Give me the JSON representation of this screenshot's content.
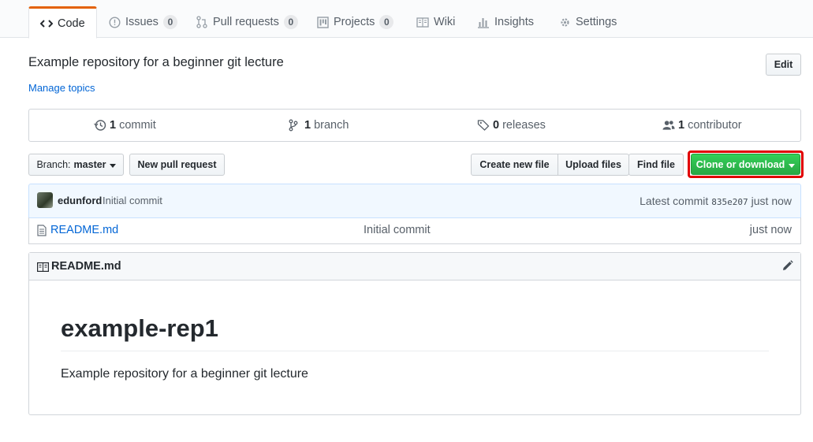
{
  "tabs": [
    {
      "label": "Code",
      "icon": "code-icon"
    },
    {
      "label": "Issues",
      "count": "0",
      "icon": "issue-icon"
    },
    {
      "label": "Pull requests",
      "count": "0",
      "icon": "pull-request-icon"
    },
    {
      "label": "Projects",
      "count": "0",
      "icon": "project-icon"
    },
    {
      "label": "Wiki",
      "icon": "book-icon"
    },
    {
      "label": "Insights",
      "icon": "graph-icon"
    },
    {
      "label": "Settings",
      "icon": "gear-icon"
    }
  ],
  "repo": {
    "description": "Example repository for a beginner git lecture",
    "manage_topics": "Manage topics",
    "edit_label": "Edit"
  },
  "stats": {
    "commits_count": "1",
    "commits_label": "commit",
    "branches_count": "1",
    "branches_label": "branch",
    "releases_count": "0",
    "releases_label": "releases",
    "contributors_count": "1",
    "contributors_label": "contributor"
  },
  "toolbar": {
    "branch_prefix": "Branch:",
    "branch_name": "master",
    "new_pr": "New pull request",
    "create_file": "Create new file",
    "upload_files": "Upload files",
    "find_file": "Find file",
    "clone": "Clone or download",
    "clone_color": "#28a745",
    "highlight_color": "#e00000"
  },
  "commit": {
    "author": "edunford",
    "message": "Initial commit",
    "latest_label": "Latest commit",
    "sha": "835e207",
    "time": "just now"
  },
  "files": [
    {
      "name": "README.md",
      "message": "Initial commit",
      "age": "just now"
    }
  ],
  "readme": {
    "file_label": "README.md",
    "heading": "example-rep1",
    "body": "Example repository for a beginner git lecture"
  }
}
